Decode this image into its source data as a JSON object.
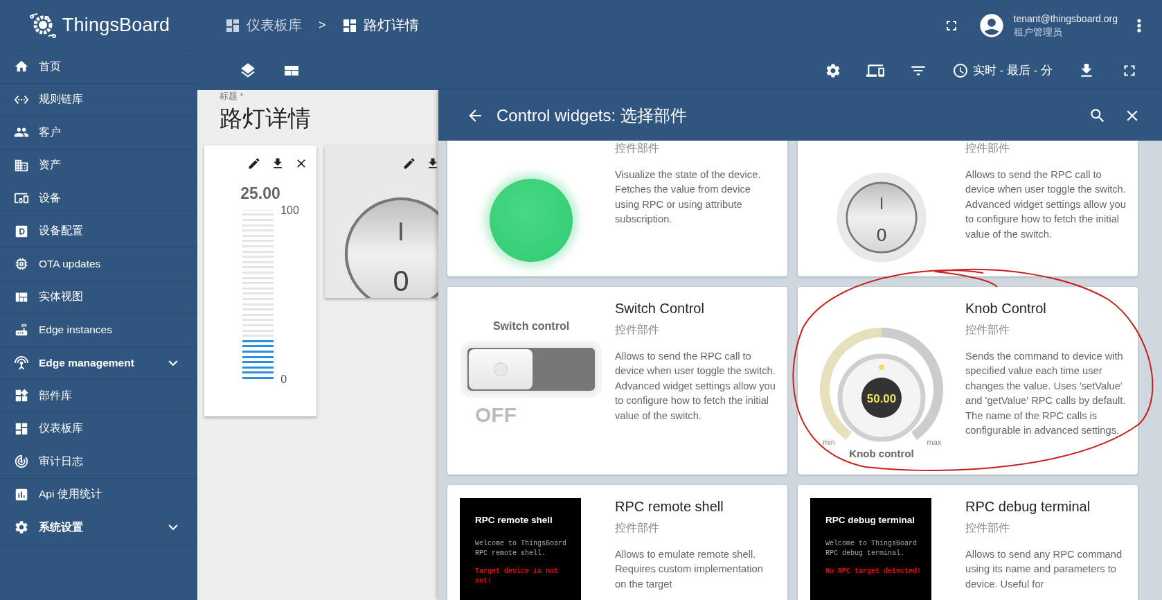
{
  "sidebar": {
    "logo": "ThingsBoard",
    "items": [
      {
        "label": "首页",
        "kind": "link"
      },
      {
        "label": "规则链库",
        "kind": "link"
      },
      {
        "label": "客户",
        "kind": "link"
      },
      {
        "label": "资产",
        "kind": "link"
      },
      {
        "label": "设备",
        "kind": "link"
      },
      {
        "label": "设备配置",
        "kind": "link"
      },
      {
        "label": "OTA updates",
        "kind": "link"
      },
      {
        "label": "实体视图",
        "kind": "link"
      },
      {
        "label": "Edge instances",
        "kind": "link"
      },
      {
        "label": "Edge management",
        "kind": "group",
        "expanded": false
      },
      {
        "label": "部件库",
        "kind": "link"
      },
      {
        "label": "仪表板库",
        "kind": "link"
      },
      {
        "label": "审计日志",
        "kind": "link"
      },
      {
        "label": "Api 使用统计",
        "kind": "link"
      },
      {
        "label": "系统设置",
        "kind": "group",
        "expanded": false
      }
    ]
  },
  "header": {
    "breadcrumbs": [
      {
        "label": "仪表板库",
        "current": false
      },
      {
        "label": "路灯详情",
        "current": true
      }
    ],
    "separator": ">",
    "user": {
      "email": "tenant@thingsboard.org",
      "role": "租户管理员"
    }
  },
  "toolbar": {
    "timewindow": "实时 - 最后 - 分"
  },
  "dashboard": {
    "title_label": "标题 *",
    "title": "路灯详情",
    "widgets": [
      {
        "kind": "bar_gauge",
        "value": "25.00",
        "max_label": "100",
        "min_label": "0",
        "level": 0.25
      },
      {
        "kind": "round_switch",
        "on_label": "I",
        "off_label": "0"
      }
    ]
  },
  "panel": {
    "title": "Control widgets: 选择部件",
    "cards": [
      {
        "kind": "led",
        "subtitle": "控件部件",
        "description": "Visualize the state of the device. Fetches the value from device using RPC or using attribute subscription."
      },
      {
        "kind": "round_switch",
        "subtitle": "控件部件",
        "on_label": "I",
        "off_label": "0",
        "description": "Allows to send the RPC call to device when user toggle the switch. Advanced widget settings allow you to configure how to fetch the initial value of the switch."
      },
      {
        "kind": "switch",
        "title": "Switch Control",
        "subtitle": "控件部件",
        "preview_title": "Switch control",
        "on": false,
        "state_label": "OFF",
        "description": "Allows to send the RPC call to device when user toggle the switch. Advanced widget settings allow you to configure how to fetch the initial value of the switch."
      },
      {
        "kind": "knob",
        "title": "Knob Control",
        "subtitle": "控件部件",
        "preview_title": "Knob control",
        "value": "50.00",
        "level": 0.5,
        "min_label": "min",
        "max_label": "max",
        "description": "Sends the command to device with specified value each time user changes the value. Uses 'setValue' and 'getValue' RPC calls by default. The name of the RPC calls is configurable in advanced settings."
      },
      {
        "kind": "terminal",
        "title": "RPC remote shell",
        "subtitle": "控件部件",
        "preview_title": "RPC remote shell",
        "console_lines": [
          "Welcome to ThingsBoard",
          "RPC remote shell."
        ],
        "error": "Target device is not set!",
        "description": "Allows to emulate remote shell. Requires custom implementation on the target"
      },
      {
        "kind": "terminal",
        "title": "RPC debug terminal",
        "subtitle": "控件部件",
        "preview_title": "RPC debug terminal",
        "console_lines": [
          "Welcome to ThingsBoard",
          "RPC debug terminal."
        ],
        "error": "No RPC target detected!",
        "description": "Allows to send any RPC command using its name and parameters to device. Useful for"
      }
    ]
  }
}
